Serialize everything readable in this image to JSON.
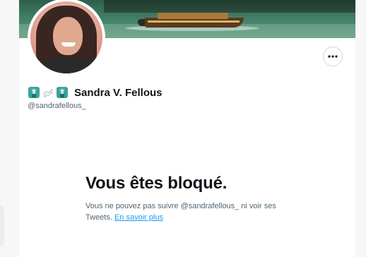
{
  "profile": {
    "display_name": "Sandra V. Fellous",
    "handle": "@sandrafellous_",
    "name_emojis": [
      "statue-of-liberty-emoji",
      "dove-emoji",
      "statue-of-liberty-emoji"
    ],
    "more_button_icon": "more-horizontal-icon"
  },
  "blocked": {
    "title": "Vous êtes bloqué.",
    "message": "Vous ne pouvez pas suivre @sandrafellous_ ni voir ses Tweets.",
    "learn_more": "En savoir plus"
  },
  "colors": {
    "link": "#1d9bf0",
    "secondary_text": "#536471",
    "primary_text": "#0f1419",
    "border": "#cfd9de"
  }
}
